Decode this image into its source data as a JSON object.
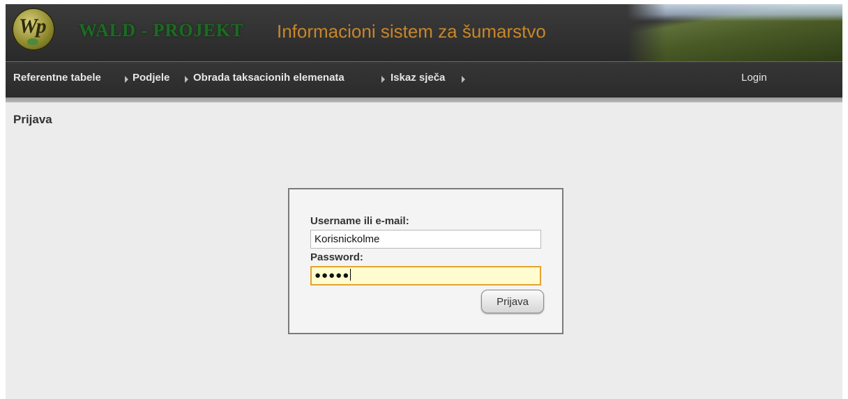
{
  "header": {
    "logo_text": "Wp",
    "brand": "WALD - PROJEKT",
    "title": "Informacioni sistem za šumarstvo"
  },
  "nav": {
    "items": [
      {
        "label": "Referentne tabele"
      },
      {
        "label": "Podjele"
      },
      {
        "label": "Obrada taksacionih elemenata"
      },
      {
        "label": "Iskaz sječa"
      }
    ],
    "login": "Login"
  },
  "page": {
    "heading": "Prijava"
  },
  "login_form": {
    "username_label": "Username ili e-mail:",
    "username_value": "Korisnickolme",
    "password_label": "Password:",
    "password_masked": "●●●●●",
    "submit_label": "Prijava"
  },
  "colors": {
    "header_bg": "#2f2f2f",
    "brand_green": "#1e6a24",
    "title_orange": "#c8862a",
    "focus_border": "#e6a22e",
    "focus_bg": "#fffccf"
  }
}
